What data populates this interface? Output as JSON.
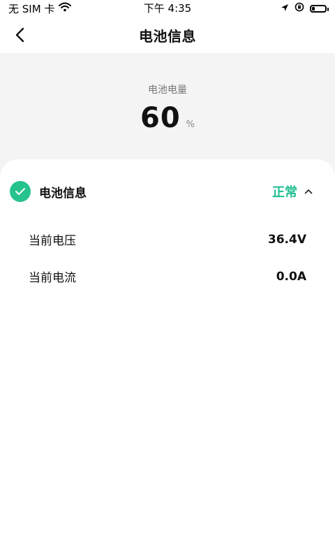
{
  "status_bar": {
    "carrier": "无 SIM 卡",
    "time": "下午 4:35"
  },
  "nav": {
    "title": "电池信息"
  },
  "battery_level": {
    "label": "电池电量",
    "value": "60",
    "unit": "%"
  },
  "info_section": {
    "title": "电池信息",
    "status": "正常",
    "rows": [
      {
        "label": "当前电压",
        "value": "36.4V"
      },
      {
        "label": "当前电流",
        "value": "0.0A"
      }
    ]
  },
  "colors": {
    "accent": "#26c38d",
    "status_text": "#1fbf8f",
    "gray_bg": "#f4f4f4"
  },
  "icons": {
    "back": "chevron-left-icon",
    "check": "check-icon",
    "expand": "chevron-up-icon",
    "wifi": "wifi-icon",
    "location": "location-arrow-icon",
    "rotation_lock": "rotation-lock-icon",
    "battery": "battery-icon"
  }
}
